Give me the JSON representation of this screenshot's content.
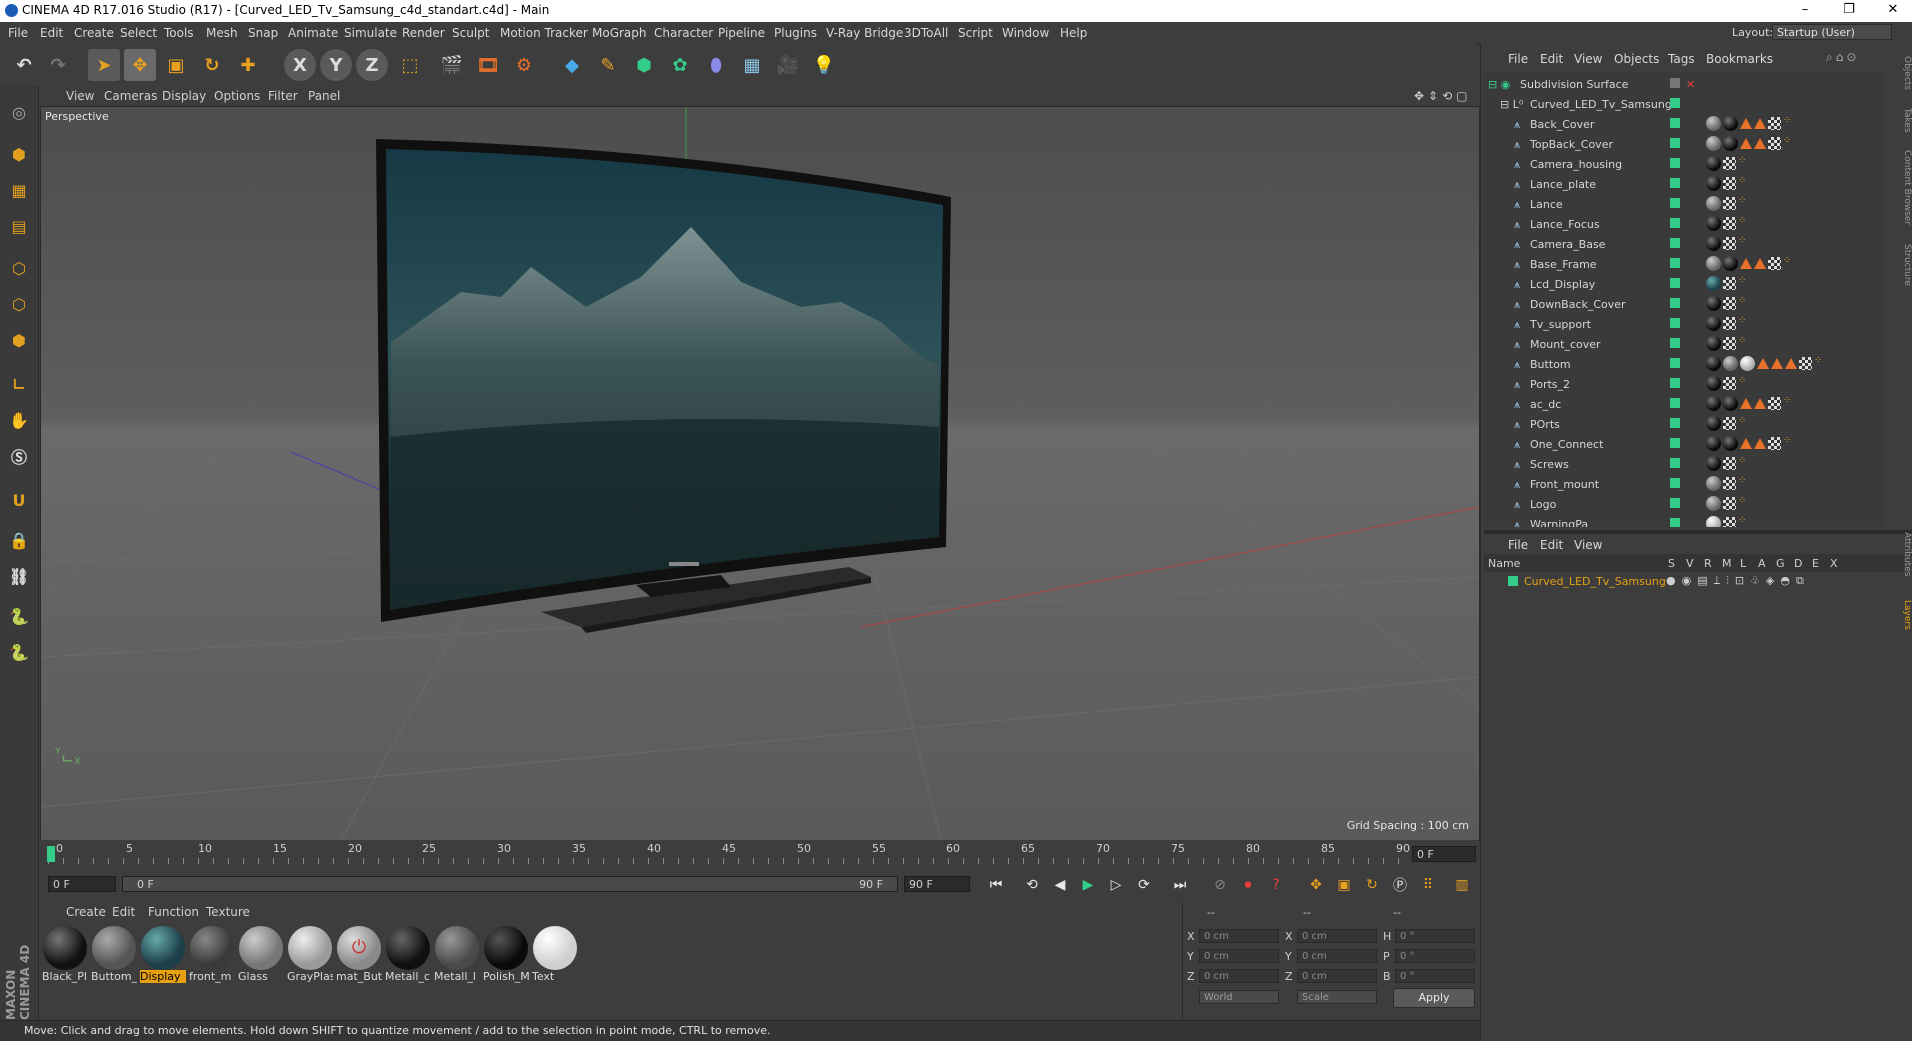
{
  "window": {
    "title": "CINEMA 4D R17.016 Studio (R17) - [Curved_LED_Tv_Samsung_c4d_standart.c4d] - Main",
    "minimize": "–",
    "restore": "❐",
    "close": "✕"
  },
  "menubar": [
    "File",
    "Edit",
    "Create",
    "Select",
    "Tools",
    "Mesh",
    "Snap",
    "Animate",
    "Simulate",
    "Render",
    "Sculpt",
    "Motion Tracker",
    "MoGraph",
    "Character",
    "Pipeline",
    "Plugins",
    "V-Ray Bridge",
    "3DToAll",
    "Script",
    "Window",
    "Help"
  ],
  "layout": {
    "label": "Layout:",
    "value": "Startup (User)"
  },
  "toolbar": {
    "x_label": "X",
    "y_label": "Y",
    "z_label": "Z"
  },
  "viewport": {
    "menu": [
      "View",
      "Cameras",
      "Display",
      "Options",
      "Filter",
      "Panel"
    ],
    "label": "Perspective",
    "grid_spacing": "Grid Spacing : 100 cm"
  },
  "timeline": {
    "ticks": [
      "0",
      "5",
      "10",
      "15",
      "20",
      "25",
      "30",
      "35",
      "40",
      "45",
      "50",
      "55",
      "60",
      "65",
      "70",
      "75",
      "80",
      "85",
      "90"
    ],
    "current_frame": "0 F",
    "start_field": "0 F",
    "range_start": "0 F",
    "range_end": "90 F",
    "end_field": "90 F"
  },
  "material_manager": {
    "menu": [
      "Create",
      "Edit",
      "Function",
      "Texture"
    ],
    "materials": [
      {
        "name": "Black_Pl",
        "color": "#111111"
      },
      {
        "name": "Buttom_",
        "color": "#555555"
      },
      {
        "name": "Display",
        "color": "#1d3f4a",
        "selected": true
      },
      {
        "name": "front_m",
        "color": "#3a3a3a"
      },
      {
        "name": "Glass",
        "color": "#777777"
      },
      {
        "name": "GrayPlas",
        "color": "#9a9a9a"
      },
      {
        "name": "mat_But",
        "color": "#8a8a8a"
      },
      {
        "name": "Metall_c",
        "color": "#101010"
      },
      {
        "name": "Metall_l",
        "color": "#4a4a4a"
      },
      {
        "name": "Polish_M",
        "color": "#0a0a0a"
      },
      {
        "name": "Text",
        "color": "#cfcfcf"
      }
    ]
  },
  "coordinates": {
    "headers": [
      "--",
      "--",
      "--"
    ],
    "rows": [
      {
        "a": "X",
        "av": "0 cm",
        "b": "X",
        "bv": "0 cm",
        "c": "H",
        "cv": "0 °"
      },
      {
        "a": "Y",
        "av": "0 cm",
        "b": "Y",
        "bv": "0 cm",
        "c": "P",
        "cv": "0 °"
      },
      {
        "a": "Z",
        "av": "0 cm",
        "b": "Z",
        "bv": "0 cm",
        "c": "B",
        "cv": "0 °"
      }
    ],
    "world": "World",
    "scale": "Scale",
    "apply": "Apply"
  },
  "status": "Move: Click and drag to move elements. Hold down SHIFT to quantize movement / add to the selection in point mode, CTRL to remove.",
  "object_manager": {
    "menu": [
      "File",
      "Edit",
      "View",
      "Objects",
      "Tags",
      "Bookmarks"
    ],
    "root": "Subdivision Surface",
    "group": "Curved_LED_Tv_Samsung",
    "objects": [
      {
        "name": "Back_Cover",
        "tags": [
          "g",
          "k",
          "t",
          "t",
          "c",
          "d"
        ]
      },
      {
        "name": "TopBack_Cover",
        "tags": [
          "g",
          "k",
          "t",
          "t",
          "c",
          "d"
        ]
      },
      {
        "name": "Camera_housing",
        "tags": [
          "k",
          "c",
          "d"
        ]
      },
      {
        "name": "Lance_plate",
        "tags": [
          "k",
          "c",
          "d"
        ]
      },
      {
        "name": "Lance",
        "tags": [
          "g",
          "c",
          "d"
        ]
      },
      {
        "name": "Lance_Focus",
        "tags": [
          "k",
          "c",
          "d"
        ]
      },
      {
        "name": "Camera_Base",
        "tags": [
          "k",
          "c",
          "d"
        ]
      },
      {
        "name": "Base_Frame",
        "tags": [
          "g",
          "k",
          "t",
          "t",
          "c",
          "d"
        ]
      },
      {
        "name": "Lcd_Display",
        "tags": [
          "b",
          "c",
          "d"
        ]
      },
      {
        "name": "DownBack_Cover",
        "tags": [
          "k",
          "c",
          "d"
        ]
      },
      {
        "name": "Tv_support",
        "tags": [
          "k",
          "c",
          "d"
        ]
      },
      {
        "name": "Mount_cover",
        "tags": [
          "k",
          "c",
          "d"
        ]
      },
      {
        "name": "Buttom",
        "tags": [
          "k",
          "g",
          "w",
          "t",
          "t",
          "t",
          "c",
          "d"
        ]
      },
      {
        "name": "Ports_2",
        "tags": [
          "k",
          "c",
          "d"
        ]
      },
      {
        "name": "ac_dc",
        "tags": [
          "k",
          "k",
          "t",
          "t",
          "c",
          "d"
        ]
      },
      {
        "name": "POrts",
        "tags": [
          "k",
          "c",
          "d"
        ]
      },
      {
        "name": "One_Connect",
        "tags": [
          "k",
          "k",
          "t",
          "t",
          "c",
          "d"
        ]
      },
      {
        "name": "Screws",
        "tags": [
          "k",
          "c",
          "d"
        ]
      },
      {
        "name": "Front_mount",
        "tags": [
          "g",
          "c",
          "d"
        ]
      },
      {
        "name": "Logo",
        "tags": [
          "g",
          "c",
          "d"
        ]
      },
      {
        "name": "WarningPa",
        "tags": [
          "w",
          "c",
          "d"
        ]
      }
    ]
  },
  "layer_manager": {
    "menu": [
      "File",
      "Edit",
      "View"
    ],
    "columns": [
      "Name",
      "S",
      "V",
      "R",
      "M",
      "L",
      "A",
      "G",
      "D",
      "E",
      "X"
    ],
    "layer": "Curved_LED_Tv_Samsung"
  },
  "side_tabs": [
    "Objects",
    "Takes",
    "Content Browser",
    "Structure",
    "Attributes",
    "Layers"
  ],
  "maxon": "MAXON CINEMA 4D",
  "colors": {
    "accent": "#e6a010",
    "visible": "#33cc88",
    "tag_orange": "#e8702a"
  }
}
